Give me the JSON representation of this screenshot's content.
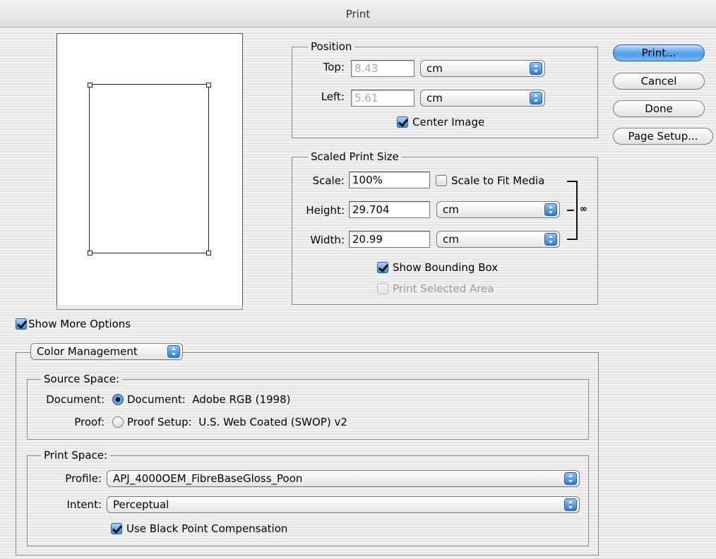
{
  "window": {
    "title": "Print"
  },
  "position": {
    "legend": "Position",
    "top_label": "Top:",
    "top_value": "8.43",
    "top_unit": "cm",
    "left_label": "Left:",
    "left_value": "5.61",
    "left_unit": "cm",
    "center_image_label": "Center Image",
    "center_image_checked": true
  },
  "scaled": {
    "legend": "Scaled Print Size",
    "scale_label": "Scale:",
    "scale_value": "100%",
    "fit_media_label": "Scale to Fit Media",
    "fit_media_checked": false,
    "height_label": "Height:",
    "height_value": "29.704",
    "height_unit": "cm",
    "width_label": "Width:",
    "width_value": "20.99",
    "width_unit": "cm",
    "bounding_box_label": "Show Bounding Box",
    "bounding_box_checked": true,
    "selected_area_label": "Print Selected Area",
    "selected_area_checked": false
  },
  "buttons": {
    "print": "Print...",
    "cancel": "Cancel",
    "done": "Done",
    "page_setup": "Page Setup..."
  },
  "more_options": {
    "label": "Show More Options",
    "checked": true,
    "dropdown": "Color Management"
  },
  "source_space": {
    "legend": "Source Space:",
    "document_label": "Document:",
    "document_option": "Document:  Adobe RGB (1998)",
    "proof_label": "Proof:",
    "proof_option": "Proof Setup:  U.S. Web Coated (SWOP) v2",
    "selected": "Document"
  },
  "print_space": {
    "legend": "Print Space:",
    "profile_label": "Profile:",
    "profile_value": "APJ_4000OEM_FibreBaseGloss_Poon",
    "intent_label": "Intent:",
    "intent_value": "Perceptual",
    "bpc_label": "Use Black Point Compensation",
    "bpc_checked": true
  },
  "colors": {
    "accent": "#3d89de",
    "default_button": "#4f9bea"
  }
}
